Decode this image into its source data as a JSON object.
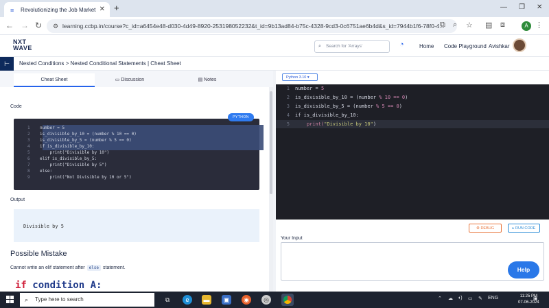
{
  "browser": {
    "tab_title": "Revolutionizing the Job Market",
    "url": "learning.ccbp.in/course?c_id=a6454e48-d030-4d49-8920-253198052232&t_id=9b13ad84-b75c-4328-9cd3-0c6751ae6b4d&s_id=7944b1f6-78f0-4...",
    "profile_initial": "A"
  },
  "site": {
    "logo_line1": "NXT",
    "logo_line2": "WAVE",
    "search_placeholder": "Search for 'Arrays'",
    "nav": [
      "Home",
      "Code Playground",
      "Avishkar"
    ]
  },
  "breadcrumb": {
    "text": "Nested Conditions > Nested Conditional Statements | Cheat Sheet"
  },
  "left_tabs": [
    "Cheat Sheet",
    "Discussion",
    "Notes"
  ],
  "cheat": {
    "code_heading": "Code",
    "language_badge": "PYTHON",
    "code_lines": [
      {
        "n": "1",
        "text": "number = 5"
      },
      {
        "n": "2",
        "text": "is_divisible_by_10 = (number % 10 == 0)"
      },
      {
        "n": "3",
        "text": "is_divisible_by_5 = (number % 5 == 0)"
      },
      {
        "n": "4",
        "text": "if is_divisible_by_10:"
      },
      {
        "n": "5",
        "text": "    print(\"Divisible by 10\")"
      },
      {
        "n": "6",
        "text": "elif is_divisible_by_5:"
      },
      {
        "n": "7",
        "text": "    print(\"Divisible by 5\")"
      },
      {
        "n": "8",
        "text": "else:"
      },
      {
        "n": "9",
        "text": "    print(\"Not Divisible by 10 or 5\")"
      }
    ],
    "output_heading": "Output",
    "output_text": "Divisible by 5",
    "mistake_heading": "Possible Mistake",
    "mistake_para_before": "Cannot write an elif statement after",
    "mistake_chip": "else",
    "mistake_para_after": "statement.",
    "big_kw": "if",
    "big_rest": " condition A:"
  },
  "editor": {
    "version": "Python 3.10",
    "lines": [
      {
        "n": "1",
        "a": "number = ",
        "b": "5",
        "c": ""
      },
      {
        "n": "2",
        "a": "is_divisible_by_10 = (number ",
        "b": "% 10 == 0",
        "c": ")"
      },
      {
        "n": "3",
        "a": "is_divisible_by_5 = (number ",
        "b": "% 5 == 0",
        "c": ")"
      },
      {
        "n": "4",
        "a": "if is_divisible_by_10:",
        "b": "",
        "c": ""
      },
      {
        "n": "5",
        "a": "    print(",
        "b": "\"Divisible by 10\"",
        "c": ")"
      }
    ],
    "debug_label": "DEBUG",
    "run_label": "RUN CODE",
    "input_label": "Your Input",
    "help_label": "Help"
  },
  "taskbar": {
    "search_placeholder": "Type here to search",
    "language": "ENG",
    "time": "11:25 PM",
    "date": "07-06-2024"
  }
}
